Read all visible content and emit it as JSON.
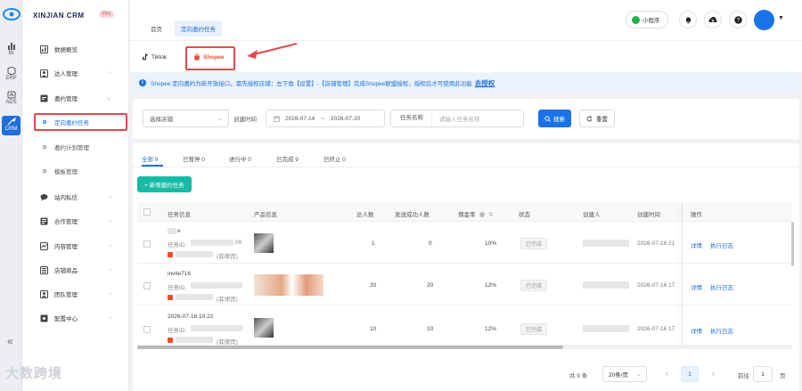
{
  "brand": {
    "name": "XINJIAN CRM",
    "badge": "Pro"
  },
  "rail": [
    {
      "label": "BI",
      "icon": "bar-chart-icon"
    },
    {
      "label": "ERP",
      "icon": "box-icon"
    },
    {
      "label": "ADS",
      "icon": "ads-icon"
    },
    {
      "label": "CRM",
      "icon": "crm-icon",
      "active": true
    }
  ],
  "rail_collapse": "«",
  "sidebar": {
    "items": [
      {
        "label": "数据概览",
        "icon": "dashboard-icon"
      },
      {
        "label": "达人管理",
        "icon": "user-group-icon"
      },
      {
        "label": "邀约管理",
        "icon": "invite-icon"
      },
      {
        "label": "站内私信",
        "icon": "chat-icon"
      },
      {
        "label": "合作管理",
        "icon": "handshake-icon"
      },
      {
        "label": "内容管理",
        "icon": "content-icon"
      },
      {
        "label": "店铺商品",
        "icon": "store-icon"
      },
      {
        "label": "团队管理",
        "icon": "team-icon"
      },
      {
        "label": "配置中心",
        "icon": "settings-icon"
      }
    ],
    "sub_items": [
      "定向邀约任务",
      "邀约计划管理",
      "模板管理"
    ]
  },
  "watermark": "大数跨境",
  "topbar": {
    "tabs": [
      "首页",
      "定向邀约任务"
    ],
    "mini_program": "小程序",
    "icons": [
      "bell-icon",
      "download-icon",
      "help-icon"
    ]
  },
  "platform_tabs": [
    "Tiktok",
    "Shopee"
  ],
  "banner": {
    "text": "Shopee 定向邀约为新开放接口，需先授权店铺：左下角【设置】-【店铺管理】完成Shopee联盟授权，授权后才可使用此功能",
    "link": "去授权"
  },
  "filters": {
    "shop_placeholder": "选择店铺",
    "created_label": "创建时间",
    "date_start": "2026-07-14",
    "date_sep": "~",
    "date_end": "2026-07-20",
    "task_name_label": "任务名称",
    "task_name_placeholder": "请输入任务名称",
    "search": "搜索",
    "reset": "重置"
  },
  "status_tabs": [
    "全部 9",
    "已暂停 0",
    "进行中 0",
    "已完成 9",
    "已终止 0"
  ],
  "add_button": "+ 新增邀约任务",
  "table": {
    "headers": [
      "任务信息",
      "产品信息",
      "达人数",
      "发送成功人数",
      "佣金率",
      "状态",
      "创建人",
      "创建时间",
      "操作"
    ],
    "rows": [
      {
        "name": "e",
        "task_id_label": "任务ID:",
        "task_id_tail": "09",
        "shop_suffix": "(菲律宾)",
        "creators": "1",
        "sent": "0",
        "commission": "10%",
        "status": "已完成",
        "created": "2026-07-16 21",
        "op_detail": "详情",
        "op_log": "执行日志"
      },
      {
        "name": "invite716",
        "task_id_label": "任务ID:",
        "task_id_tail": "",
        "shop_suffix": "(菲律宾)",
        "creators": "20",
        "sent": "20",
        "commission": "12%",
        "status": "已完成",
        "created": "2026-07-16 17",
        "op_detail": "详情",
        "op_log": "执行日志"
      },
      {
        "name": "2026-07-16 10.22",
        "task_id_label": "任务ID:",
        "task_id_tail": "",
        "shop_suffix": "(菲律宾)",
        "creators": "10",
        "sent": "10",
        "commission": "12%",
        "status": "已完成",
        "created": "2026-07-16 17",
        "op_detail": "详情",
        "op_log": "执行日志"
      }
    ]
  },
  "pagination": {
    "total": "共 9 条",
    "page_size": "20条/页",
    "prev": "‹",
    "current": "1",
    "next": "›",
    "goto_label": "前往",
    "goto_value": "1",
    "page_unit": "页"
  },
  "colors": {
    "primary": "#1a73e8",
    "accent_teal": "#17bba5",
    "shopee": "#ee4d2d",
    "highlight_red": "#e24a4a"
  }
}
